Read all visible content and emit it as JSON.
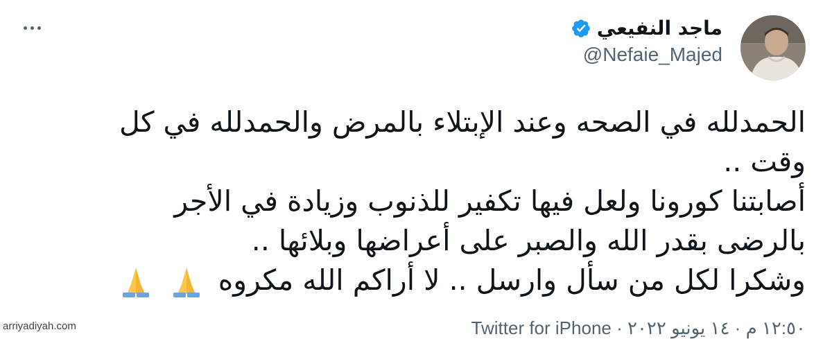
{
  "tweet": {
    "author_name": "ماجد النفيعي",
    "handle": "@Nefaie_Majed",
    "lines": [
      "الحمدلله في الصحه وعند الإبتلاء بالمرض والحمدلله في كل",
      "وقت ..",
      "أصابتنا كورونا ولعل فيها تكفير للذنوب وزيادة في الأجر",
      "بالرضى بقدر الله والصبر على أعراضها وبلائها ..",
      "وشكرا لكل من سأل وارسل .. لا أراكم الله مكروه"
    ],
    "emoji": "folded-hands-icon",
    "meta_time": "١٢:٥٠ م",
    "meta_date": "١٤ يونيو ٢٠٢٢",
    "meta_client": "Twitter for iPhone"
  },
  "watermark": "arriyadiyah.com",
  "colors": {
    "verified_blue": "#1d9bf0",
    "text": "#0f1419",
    "secondary": "#536471"
  }
}
